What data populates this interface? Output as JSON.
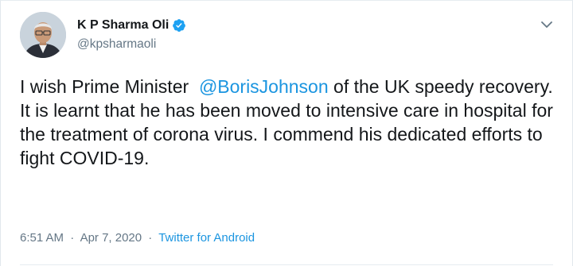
{
  "author": {
    "display_name": "K P Sharma Oli",
    "handle": "@kpsharmaoli",
    "verified": true
  },
  "tweet": {
    "text_before_mention": "I wish Prime Minister  ",
    "mention": "@BorisJohnson",
    "text_after_mention": " of the UK speedy recovery.  It is learnt that he has been moved to intensive care in hospital for the treatment of corona virus. I commend his dedicated efforts to fight COVID-19."
  },
  "meta": {
    "time": "6:51 AM",
    "separator": "·",
    "date": "Apr 7, 2020",
    "source": "Twitter for Android"
  },
  "icons": {
    "verified": "verified-badge-icon",
    "caret": "chevron-down-icon"
  },
  "colors": {
    "link": "#1b95e0",
    "secondary_text": "#657786",
    "primary_text": "#14171a"
  }
}
